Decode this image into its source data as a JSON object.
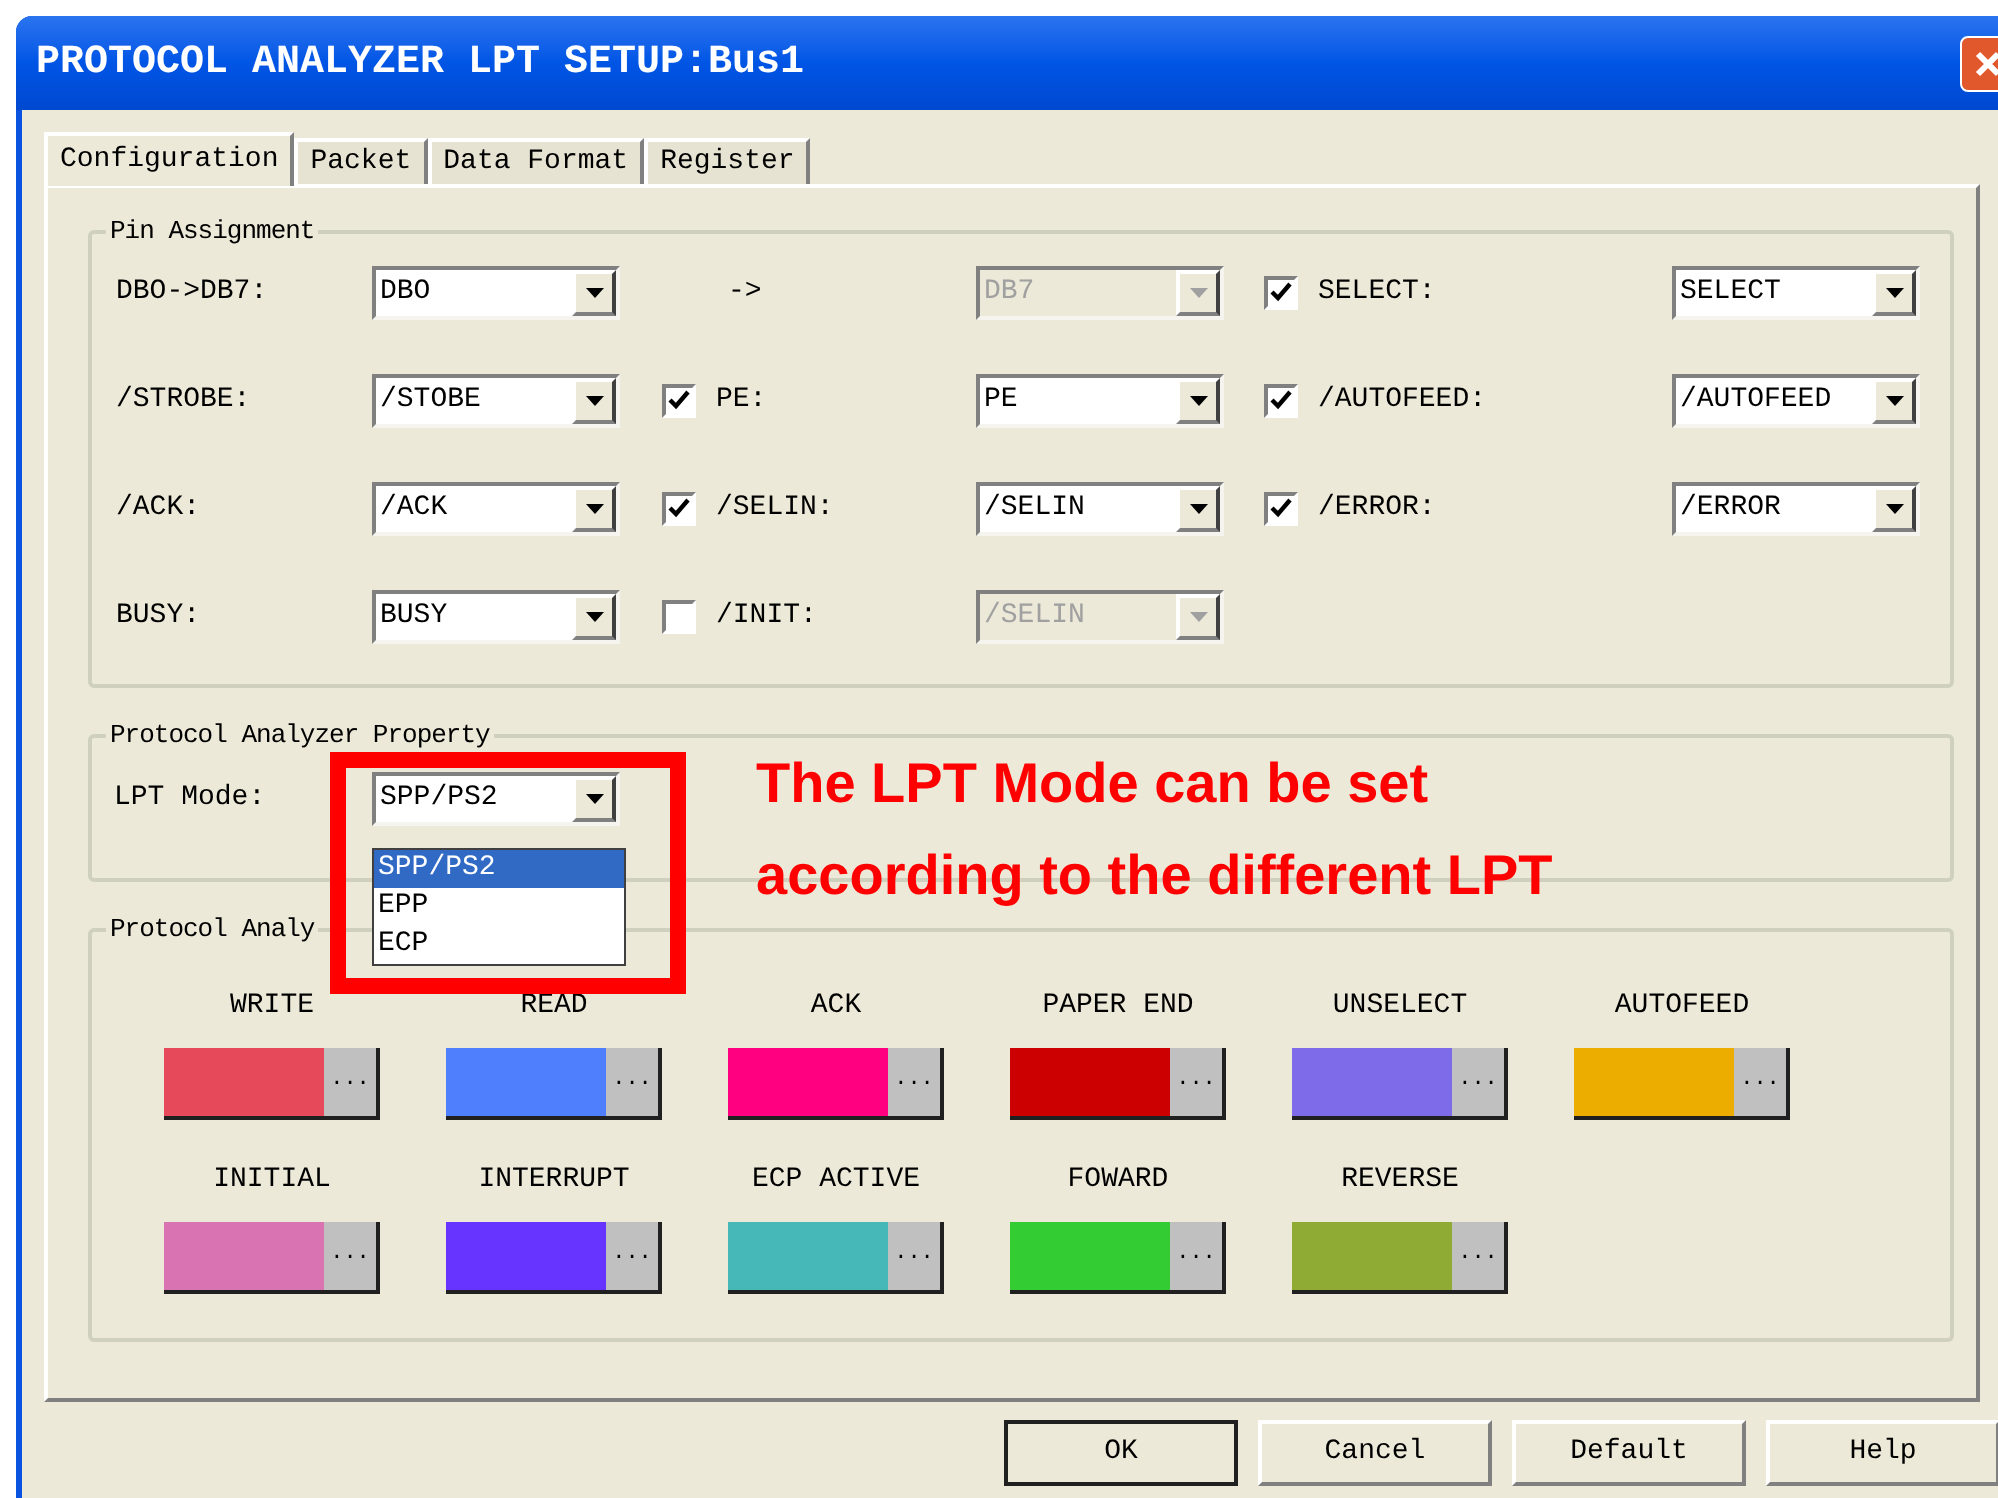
{
  "window": {
    "title": "PROTOCOL ANALYZER LPT SETUP:Bus1"
  },
  "tabs": [
    {
      "label": "Configuration",
      "selected": true
    },
    {
      "label": "Packet",
      "selected": false
    },
    {
      "label": "Data Format",
      "selected": false
    },
    {
      "label": "Register",
      "selected": false
    }
  ],
  "pin_assignment": {
    "title": "Pin Assignment",
    "rows": [
      {
        "cells": [
          {
            "kind": "label",
            "text": "DBO->DB7:"
          },
          {
            "kind": "combo",
            "value": "DBO",
            "disabled": false
          },
          {
            "kind": "text",
            "text": "->"
          },
          {
            "kind": "combo",
            "value": "DB7",
            "disabled": true
          },
          {
            "kind": "check",
            "label": "SELECT:",
            "checked": true
          },
          {
            "kind": "combo",
            "value": "SELECT",
            "disabled": false
          }
        ]
      },
      {
        "cells": [
          {
            "kind": "label",
            "text": "/STROBE:"
          },
          {
            "kind": "combo",
            "value": "/STOBE",
            "disabled": false
          },
          {
            "kind": "check",
            "label": "PE:",
            "checked": true
          },
          {
            "kind": "combo",
            "value": "PE",
            "disabled": false
          },
          {
            "kind": "check",
            "label": "/AUTOFEED:",
            "checked": true
          },
          {
            "kind": "combo",
            "value": "/AUTOFEED",
            "disabled": false
          }
        ]
      },
      {
        "cells": [
          {
            "kind": "label",
            "text": "/ACK:"
          },
          {
            "kind": "combo",
            "value": "/ACK",
            "disabled": false
          },
          {
            "kind": "check",
            "label": "/SELIN:",
            "checked": true
          },
          {
            "kind": "combo",
            "value": "/SELIN",
            "disabled": false
          },
          {
            "kind": "check",
            "label": "/ERROR:",
            "checked": true
          },
          {
            "kind": "combo",
            "value": "/ERROR",
            "disabled": false
          }
        ]
      },
      {
        "cells": [
          {
            "kind": "label",
            "text": "BUSY:"
          },
          {
            "kind": "combo",
            "value": "BUSY",
            "disabled": false
          },
          {
            "kind": "check",
            "label": "/INIT:",
            "checked": false
          },
          {
            "kind": "combo",
            "value": "/SELIN",
            "disabled": true
          }
        ]
      }
    ]
  },
  "property": {
    "title": "Protocol Analyzer Property",
    "label": "LPT Mode:",
    "value": "SPP/PS2",
    "options": [
      {
        "label": "SPP/PS2",
        "selected": true
      },
      {
        "label": "EPP",
        "selected": false
      },
      {
        "label": "ECP",
        "selected": false
      }
    ]
  },
  "colors": {
    "title": "Protocol Analy",
    "items": [
      {
        "label": "WRITE",
        "color": "#e64a5a"
      },
      {
        "label": "READ",
        "color": "#4f7ffc"
      },
      {
        "label": "ACK",
        "color": "#ff0080"
      },
      {
        "label": "PAPER END",
        "color": "#cc0000"
      },
      {
        "label": "UNSELECT",
        "color": "#7d6bea"
      },
      {
        "label": "AUTOFEED",
        "color": "#ecad00"
      },
      {
        "label": "INITIAL",
        "color": "#d973b2"
      },
      {
        "label": "INTERRUPT",
        "color": "#6633ff"
      },
      {
        "label": "ECP ACTIVE",
        "color": "#47b8b8"
      },
      {
        "label": "FOWARD",
        "color": "#33cc33"
      },
      {
        "label": "REVERSE",
        "color": "#8fab33"
      }
    ],
    "button": "..."
  },
  "buttons": [
    {
      "label": "OK",
      "default": true
    },
    {
      "label": "Cancel",
      "default": false
    },
    {
      "label": "Default",
      "default": false
    },
    {
      "label": "Help",
      "default": false
    }
  ],
  "annotation": {
    "lines": [
      "The LPT Mode can be set",
      "according to the different LPT"
    ]
  }
}
